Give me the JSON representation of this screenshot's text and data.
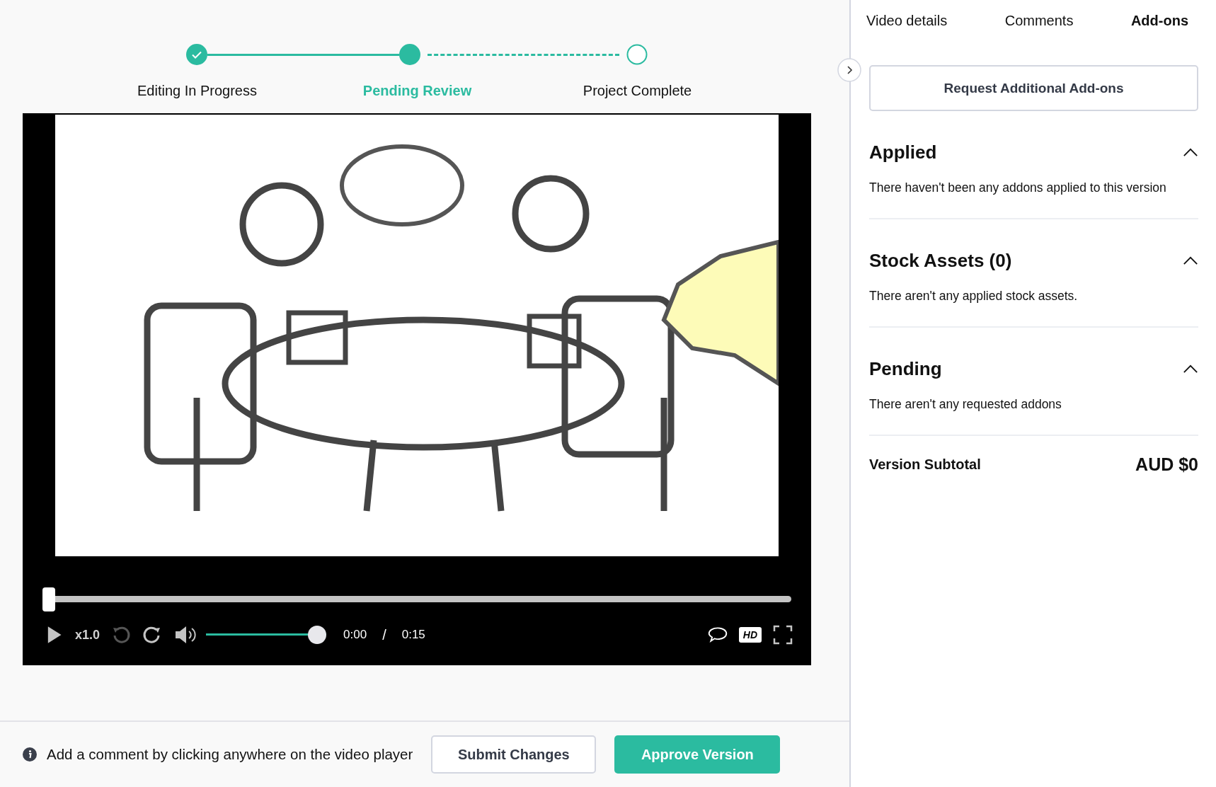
{
  "stepper": {
    "steps": [
      {
        "label": "Editing In Progress",
        "completed": true,
        "selected": false
      },
      {
        "label": "Pending Review",
        "completed": false,
        "selected": true
      },
      {
        "label": "Project Complete",
        "completed": false,
        "selected": false
      }
    ]
  },
  "player": {
    "progress": {
      "level": 0
    },
    "playing": false,
    "speed": "x1.0",
    "volume": {
      "level": 1
    },
    "time_current": "0:00",
    "time_separator": "/",
    "time_total": "0:15",
    "hd_label": "HD"
  },
  "comment_hint": "Add a comment by clicking anywhere on the video player",
  "actions": [
    {
      "label": "Submit Changes",
      "kind": "secondary"
    },
    {
      "label": "Approve Version",
      "kind": "primary"
    }
  ],
  "tabs": [
    {
      "label": "Video details",
      "selected": false
    },
    {
      "label": "Comments",
      "selected": false
    },
    {
      "label": "Add-ons",
      "selected": true
    }
  ],
  "request_button": "Request Additional Add-ons",
  "sections": [
    {
      "title": "Applied",
      "message": "There haven't been any addons applied to this version",
      "expanded": true
    },
    {
      "title": "Stock Assets (0)",
      "message": "There aren't any applied stock assets.",
      "expanded": true
    },
    {
      "title": "Pending",
      "message": "There aren't any requested addons",
      "expanded": true
    }
  ],
  "subtotal": {
    "label": "Version Subtotal",
    "value": "AUD $0"
  }
}
